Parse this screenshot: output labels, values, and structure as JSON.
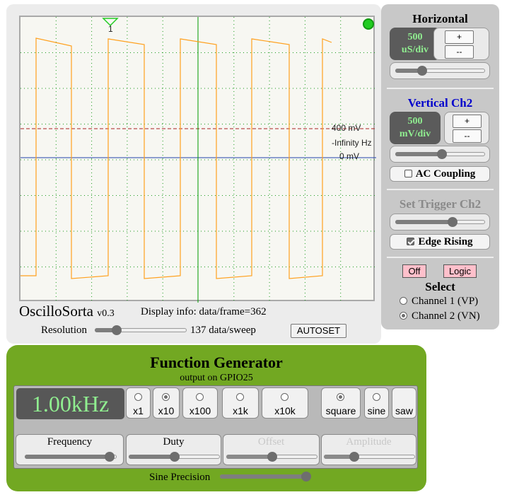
{
  "scope": {
    "trigger_marker_label": "1",
    "traces": {
      "voltage_top": "400 mV",
      "frequency": "-Infinity Hz",
      "voltage_zero": "0 mV"
    },
    "colors": {
      "waveform": "#ffa11f",
      "trigger_line": "#aa2222",
      "zero_line": "#2244aa",
      "center_line": "#009900",
      "grid": "#1a9a1a",
      "status_led": "#22cc22"
    }
  },
  "brand": {
    "name": "OscilloSorta",
    "version": "v0.3"
  },
  "display_info": "Display info: data/frame=362",
  "resolution": {
    "label": "Resolution",
    "value_text": "137 data/sweep",
    "level": 0.24
  },
  "autoset_label": "AUTOSET",
  "horizontal": {
    "title": "Horizontal",
    "scale_value": "500",
    "scale_unit": "uS/div",
    "plus_label": "+",
    "minus_label": "--",
    "slider_level": 0.3
  },
  "vertical": {
    "title": "Vertical Ch2",
    "title_color": "#0000cc",
    "scale_value": "500",
    "scale_unit": "mV/div",
    "plus_label": "+",
    "minus_label": "--",
    "slider_level": 0.52,
    "ac_coupling_label": "AC Coupling",
    "ac_coupling_checked": false
  },
  "trigger": {
    "title": "Set Trigger Ch2",
    "title_color": "#8a8a8a",
    "slider_level": 0.64,
    "edge_label": "Edge Rising",
    "edge_checked": true
  },
  "mode": {
    "off_label": "Off",
    "logic_label": "Logic",
    "select_label": "Select",
    "channels": [
      {
        "label": "Channel 1 (VP)",
        "checked": false
      },
      {
        "label": "Channel 2 (VN)",
        "checked": true
      }
    ]
  },
  "function_generator": {
    "title": "Function Generator",
    "subtitle": "output on GPIO25",
    "frequency_display": "1.00kHz",
    "multipliers": [
      {
        "label": "x1",
        "checked": false
      },
      {
        "label": "x10",
        "checked": true
      },
      {
        "label": "x100",
        "checked": false
      },
      {
        "label": "x1k",
        "checked": false
      },
      {
        "label": "x10k",
        "checked": false
      }
    ],
    "waveforms": [
      {
        "label": "square",
        "checked": true
      },
      {
        "label": "sine",
        "checked": false
      },
      {
        "label": "saw",
        "checked": false
      }
    ],
    "controls": [
      {
        "label": "Frequency",
        "level": 0.92,
        "enabled": true
      },
      {
        "label": "Duty",
        "level": 0.5,
        "enabled": true
      },
      {
        "label": "Offset",
        "level": 0.5,
        "enabled": false
      },
      {
        "label": "Amplitude",
        "level": 0.33,
        "enabled": false
      }
    ],
    "sine_precision": {
      "label": "Sine Precision",
      "level": 0.95
    }
  }
}
